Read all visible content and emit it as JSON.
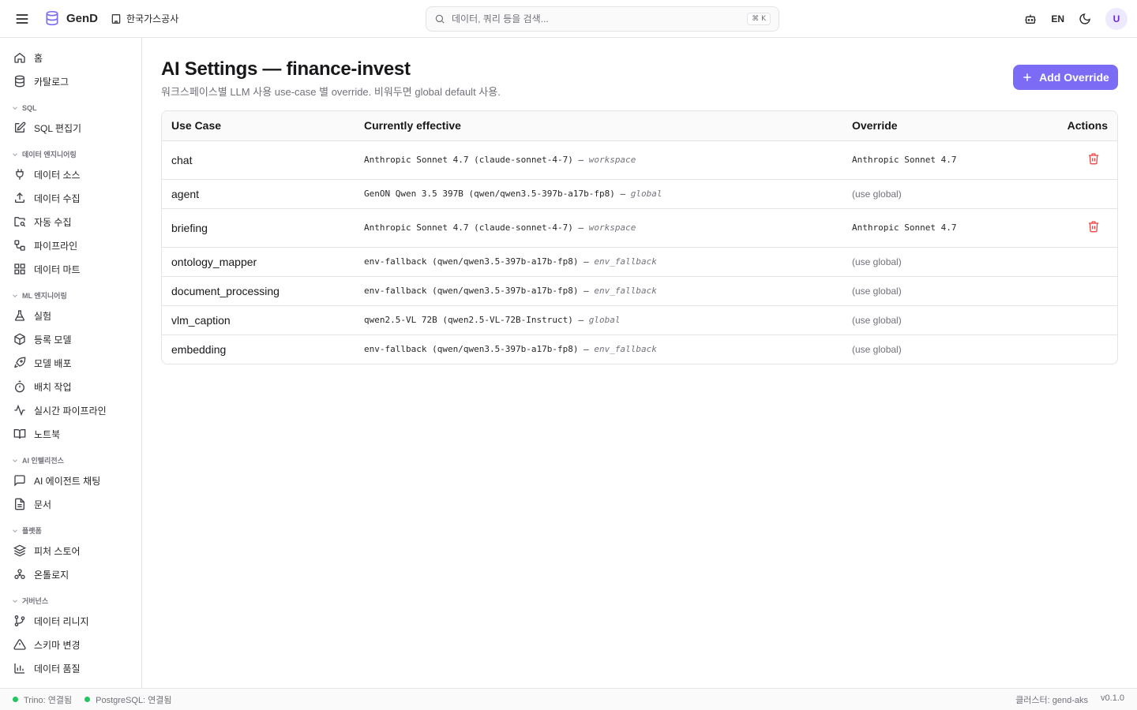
{
  "header": {
    "brand": "GenD",
    "org": "한국가스공사",
    "search_placeholder": "데이터, 쿼리 등을 검색...",
    "search_shortcut": "⌘ K",
    "lang": "EN",
    "avatar": "U"
  },
  "sidebar": {
    "top": [
      {
        "label": "홈",
        "icon": "home-icon"
      },
      {
        "label": "카탈로그",
        "icon": "database-icon"
      }
    ],
    "sections": [
      {
        "title": "SQL",
        "items": [
          {
            "label": "SQL 편집기",
            "icon": "edit-icon"
          }
        ]
      },
      {
        "title": "데이터 엔지니어링",
        "items": [
          {
            "label": "데이터 소스",
            "icon": "plug-icon"
          },
          {
            "label": "데이터 수집",
            "icon": "upload-icon"
          },
          {
            "label": "자동 수집",
            "icon": "folder-search-icon"
          },
          {
            "label": "파이프라인",
            "icon": "workflow-icon"
          },
          {
            "label": "데이터 마트",
            "icon": "grid-icon"
          }
        ]
      },
      {
        "title": "ML 엔지니어링",
        "items": [
          {
            "label": "실험",
            "icon": "flask-icon"
          },
          {
            "label": "등록 모델",
            "icon": "package-icon"
          },
          {
            "label": "모델 배포",
            "icon": "rocket-icon"
          },
          {
            "label": "배치 작업",
            "icon": "timer-icon"
          },
          {
            "label": "실시간 파이프라인",
            "icon": "activity-icon"
          },
          {
            "label": "노트북",
            "icon": "book-icon"
          }
        ]
      },
      {
        "title": "AI 인텔리전스",
        "items": [
          {
            "label": "AI 에이전트 채팅",
            "icon": "chat-icon"
          },
          {
            "label": "문서",
            "icon": "file-icon"
          }
        ]
      },
      {
        "title": "플랫폼",
        "items": [
          {
            "label": "피처 스토어",
            "icon": "layers-icon"
          },
          {
            "label": "온톨로지",
            "icon": "ontology-icon"
          }
        ]
      },
      {
        "title": "거버넌스",
        "items": [
          {
            "label": "데이터 리니지",
            "icon": "git-branch-icon"
          },
          {
            "label": "스키마 변경",
            "icon": "warning-icon"
          },
          {
            "label": "데이터 품질",
            "icon": "bar-chart-icon"
          }
        ]
      }
    ]
  },
  "main": {
    "title": "AI Settings — finance-invest",
    "subtitle": "워크스페이스별 LLM 사용 use-case 별 override. 비워두면 global default 사용.",
    "add_button": "Add Override",
    "columns": {
      "use_case": "Use Case",
      "effective": "Currently effective",
      "override": "Override",
      "actions": "Actions"
    },
    "rows": [
      {
        "use_case": "chat",
        "effective": "Anthropic Sonnet 4.7 (claude-sonnet-4-7) — ",
        "source": "workspace",
        "override": "Anthropic Sonnet 4.7",
        "has_override": true
      },
      {
        "use_case": "agent",
        "effective": "GenON Qwen 3.5 397B (qwen/qwen3.5-397b-a17b-fp8) — ",
        "source": "global",
        "override": "(use global)",
        "has_override": false
      },
      {
        "use_case": "briefing",
        "effective": "Anthropic Sonnet 4.7 (claude-sonnet-4-7) — ",
        "source": "workspace",
        "override": "Anthropic Sonnet 4.7",
        "has_override": true
      },
      {
        "use_case": "ontology_mapper",
        "effective": "env-fallback (qwen/qwen3.5-397b-a17b-fp8) — ",
        "source": "env_fallback",
        "override": "(use global)",
        "has_override": false
      },
      {
        "use_case": "document_processing",
        "effective": "env-fallback (qwen/qwen3.5-397b-a17b-fp8) — ",
        "source": "env_fallback",
        "override": "(use global)",
        "has_override": false
      },
      {
        "use_case": "vlm_caption",
        "effective": "qwen2.5-VL 72B (qwen2.5-VL-72B-Instruct) — ",
        "source": "global",
        "override": "(use global)",
        "has_override": false
      },
      {
        "use_case": "embedding",
        "effective": "env-fallback (qwen/qwen3.5-397b-a17b-fp8) — ",
        "source": "env_fallback",
        "override": "(use global)",
        "has_override": false
      }
    ]
  },
  "status": {
    "trino": "Trino: 연결됨",
    "postgres": "PostgreSQL: 연결됨",
    "cluster": "클러스터: gend-aks",
    "version": "v0.1.0"
  },
  "colors": {
    "accent": "#7c6cf5",
    "danger": "#ef4444",
    "ok": "#22c55e"
  }
}
